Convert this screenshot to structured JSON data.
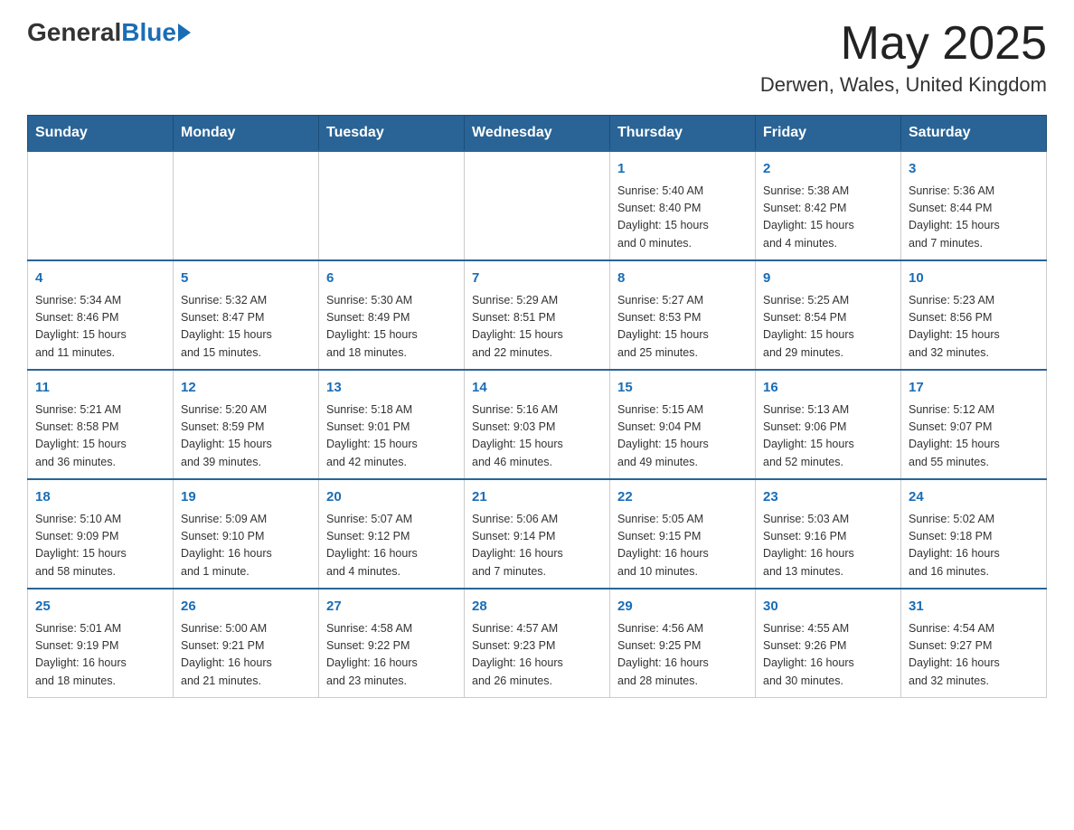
{
  "header": {
    "logo_general": "General",
    "logo_blue": "Blue",
    "month_title": "May 2025",
    "location": "Derwen, Wales, United Kingdom"
  },
  "days_of_week": [
    "Sunday",
    "Monday",
    "Tuesday",
    "Wednesday",
    "Thursday",
    "Friday",
    "Saturday"
  ],
  "weeks": [
    [
      {
        "day": "",
        "info": ""
      },
      {
        "day": "",
        "info": ""
      },
      {
        "day": "",
        "info": ""
      },
      {
        "day": "",
        "info": ""
      },
      {
        "day": "1",
        "info": "Sunrise: 5:40 AM\nSunset: 8:40 PM\nDaylight: 15 hours\nand 0 minutes."
      },
      {
        "day": "2",
        "info": "Sunrise: 5:38 AM\nSunset: 8:42 PM\nDaylight: 15 hours\nand 4 minutes."
      },
      {
        "day": "3",
        "info": "Sunrise: 5:36 AM\nSunset: 8:44 PM\nDaylight: 15 hours\nand 7 minutes."
      }
    ],
    [
      {
        "day": "4",
        "info": "Sunrise: 5:34 AM\nSunset: 8:46 PM\nDaylight: 15 hours\nand 11 minutes."
      },
      {
        "day": "5",
        "info": "Sunrise: 5:32 AM\nSunset: 8:47 PM\nDaylight: 15 hours\nand 15 minutes."
      },
      {
        "day": "6",
        "info": "Sunrise: 5:30 AM\nSunset: 8:49 PM\nDaylight: 15 hours\nand 18 minutes."
      },
      {
        "day": "7",
        "info": "Sunrise: 5:29 AM\nSunset: 8:51 PM\nDaylight: 15 hours\nand 22 minutes."
      },
      {
        "day": "8",
        "info": "Sunrise: 5:27 AM\nSunset: 8:53 PM\nDaylight: 15 hours\nand 25 minutes."
      },
      {
        "day": "9",
        "info": "Sunrise: 5:25 AM\nSunset: 8:54 PM\nDaylight: 15 hours\nand 29 minutes."
      },
      {
        "day": "10",
        "info": "Sunrise: 5:23 AM\nSunset: 8:56 PM\nDaylight: 15 hours\nand 32 minutes."
      }
    ],
    [
      {
        "day": "11",
        "info": "Sunrise: 5:21 AM\nSunset: 8:58 PM\nDaylight: 15 hours\nand 36 minutes."
      },
      {
        "day": "12",
        "info": "Sunrise: 5:20 AM\nSunset: 8:59 PM\nDaylight: 15 hours\nand 39 minutes."
      },
      {
        "day": "13",
        "info": "Sunrise: 5:18 AM\nSunset: 9:01 PM\nDaylight: 15 hours\nand 42 minutes."
      },
      {
        "day": "14",
        "info": "Sunrise: 5:16 AM\nSunset: 9:03 PM\nDaylight: 15 hours\nand 46 minutes."
      },
      {
        "day": "15",
        "info": "Sunrise: 5:15 AM\nSunset: 9:04 PM\nDaylight: 15 hours\nand 49 minutes."
      },
      {
        "day": "16",
        "info": "Sunrise: 5:13 AM\nSunset: 9:06 PM\nDaylight: 15 hours\nand 52 minutes."
      },
      {
        "day": "17",
        "info": "Sunrise: 5:12 AM\nSunset: 9:07 PM\nDaylight: 15 hours\nand 55 minutes."
      }
    ],
    [
      {
        "day": "18",
        "info": "Sunrise: 5:10 AM\nSunset: 9:09 PM\nDaylight: 15 hours\nand 58 minutes."
      },
      {
        "day": "19",
        "info": "Sunrise: 5:09 AM\nSunset: 9:10 PM\nDaylight: 16 hours\nand 1 minute."
      },
      {
        "day": "20",
        "info": "Sunrise: 5:07 AM\nSunset: 9:12 PM\nDaylight: 16 hours\nand 4 minutes."
      },
      {
        "day": "21",
        "info": "Sunrise: 5:06 AM\nSunset: 9:14 PM\nDaylight: 16 hours\nand 7 minutes."
      },
      {
        "day": "22",
        "info": "Sunrise: 5:05 AM\nSunset: 9:15 PM\nDaylight: 16 hours\nand 10 minutes."
      },
      {
        "day": "23",
        "info": "Sunrise: 5:03 AM\nSunset: 9:16 PM\nDaylight: 16 hours\nand 13 minutes."
      },
      {
        "day": "24",
        "info": "Sunrise: 5:02 AM\nSunset: 9:18 PM\nDaylight: 16 hours\nand 16 minutes."
      }
    ],
    [
      {
        "day": "25",
        "info": "Sunrise: 5:01 AM\nSunset: 9:19 PM\nDaylight: 16 hours\nand 18 minutes."
      },
      {
        "day": "26",
        "info": "Sunrise: 5:00 AM\nSunset: 9:21 PM\nDaylight: 16 hours\nand 21 minutes."
      },
      {
        "day": "27",
        "info": "Sunrise: 4:58 AM\nSunset: 9:22 PM\nDaylight: 16 hours\nand 23 minutes."
      },
      {
        "day": "28",
        "info": "Sunrise: 4:57 AM\nSunset: 9:23 PM\nDaylight: 16 hours\nand 26 minutes."
      },
      {
        "day": "29",
        "info": "Sunrise: 4:56 AM\nSunset: 9:25 PM\nDaylight: 16 hours\nand 28 minutes."
      },
      {
        "day": "30",
        "info": "Sunrise: 4:55 AM\nSunset: 9:26 PM\nDaylight: 16 hours\nand 30 minutes."
      },
      {
        "day": "31",
        "info": "Sunrise: 4:54 AM\nSunset: 9:27 PM\nDaylight: 16 hours\nand 32 minutes."
      }
    ]
  ]
}
